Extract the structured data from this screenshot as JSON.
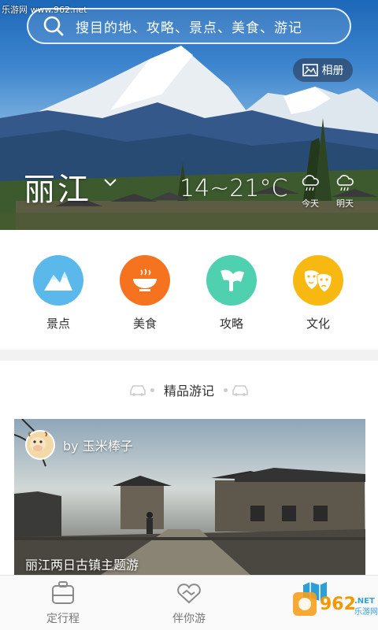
{
  "watermark_top": "乐游网 www.962.net",
  "search": {
    "placeholder": "搜目的地、攻略、景点、美食、游记"
  },
  "album_label": "相册",
  "location": {
    "city": "丽江",
    "temperature": "14~21°C"
  },
  "weather": [
    {
      "label": "今天",
      "icon": "cloud-rain-icon"
    },
    {
      "label": "明天",
      "icon": "cloud-rain-icon"
    }
  ],
  "categories": [
    {
      "label": "景点",
      "icon": "mountain-icon",
      "color": "#5ab8ea"
    },
    {
      "label": "美食",
      "icon": "bowl-icon",
      "color": "#f5731e"
    },
    {
      "label": "攻略",
      "icon": "flag-icon",
      "color": "#4fd1b0"
    },
    {
      "label": "文化",
      "icon": "masks-icon",
      "color": "#f7b812"
    }
  ],
  "section_title": "精品游记",
  "featured": {
    "author": "by 玉米棒子",
    "title": "丽江两日古镇主题游"
  },
  "nav": [
    {
      "label": "定行程",
      "icon": "luggage-icon"
    },
    {
      "label": "伴你游",
      "icon": "handshake-icon"
    },
    {
      "label": "",
      "icon": "map-icon",
      "active": true
    }
  ],
  "colors": {
    "accent": "#2d9fd8",
    "hero_sky": "#1d67b8"
  }
}
